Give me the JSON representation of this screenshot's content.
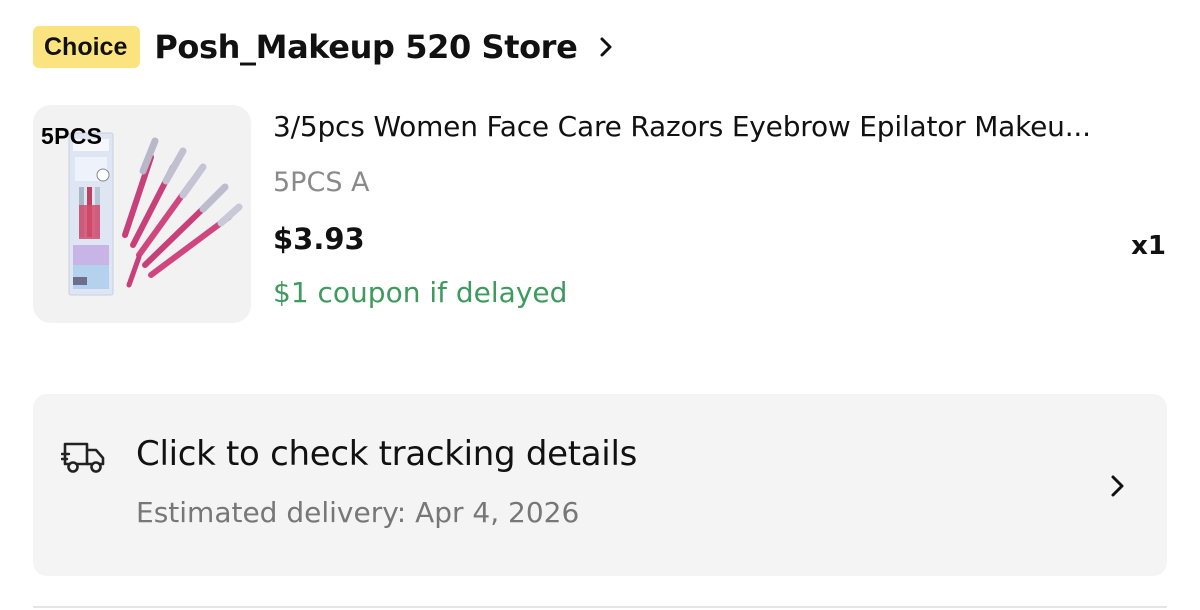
{
  "store": {
    "badge": "Choice",
    "name": "Posh_Makeup 520 Store",
    "chevron_icon": "chevron-right-icon"
  },
  "product": {
    "thumbnail_label": "5PCS",
    "title": "3/5pcs Women Face Care Razors Eyebrow Epilator Makeu...",
    "variant": "5PCS A",
    "price": "$3.93",
    "quantity": "x1",
    "coupon": "$1 coupon if delayed"
  },
  "tracking": {
    "icon": "truck-icon",
    "title": "Click to check tracking details",
    "estimated_delivery": "Estimated delivery: Apr 4, 2026",
    "chevron_icon": "chevron-right-icon"
  },
  "colors": {
    "choice_badge_bg": "#fbe480",
    "coupon_green": "#3f9a5e",
    "variant_gray": "#8a8a8a",
    "card_bg": "#f4f4f4",
    "razor_pink": "#c8407a"
  }
}
